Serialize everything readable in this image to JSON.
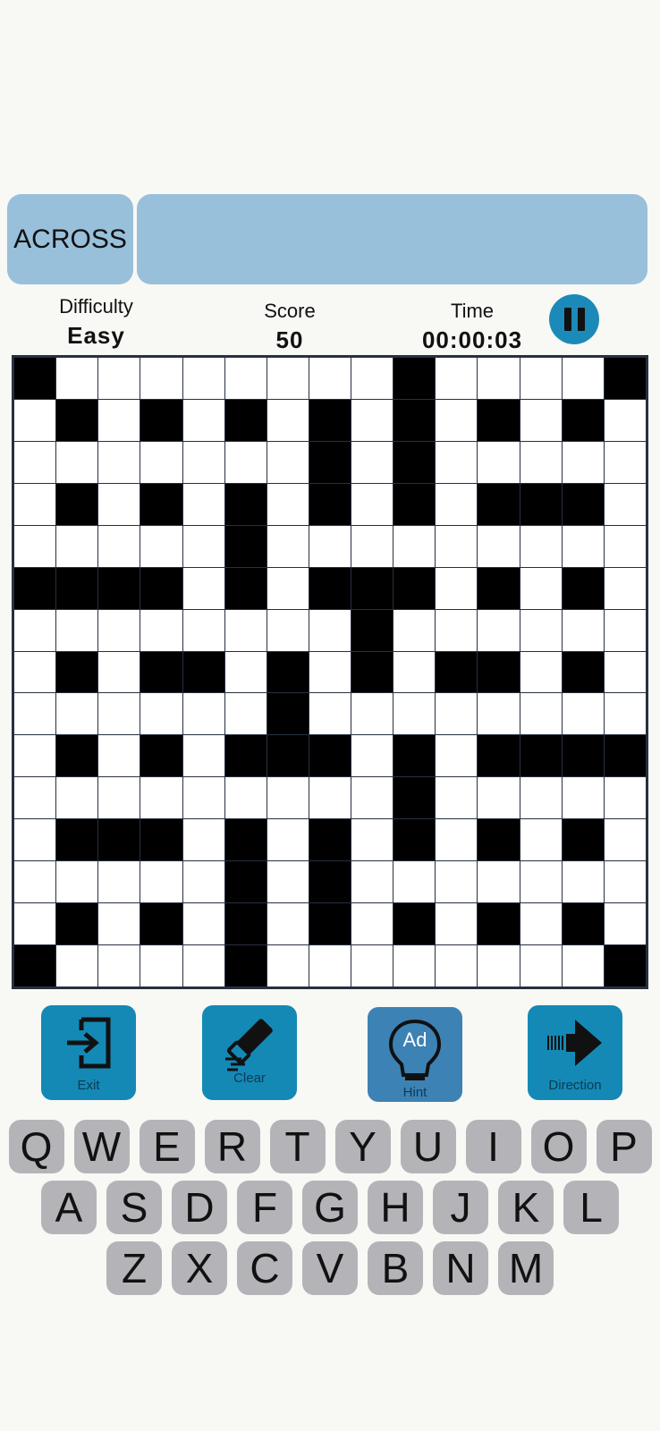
{
  "clue": {
    "direction": "ACROSS",
    "text": ""
  },
  "stats": {
    "difficulty_label": "Difficulty",
    "difficulty_value": "Easy",
    "score_label": "Score",
    "score_value": "50",
    "time_label": "Time",
    "time_value": "00:00:03"
  },
  "grid": {
    "size": 15,
    "rows": [
      "#........#....#",
      ".#.#.#.#.#.#.#.",
      ".......#.#.....",
      ".#.#.#.#.#.###.",
      ".....#.........",
      "####.#.###.#.#.",
      "........#......",
      ".#.##.#.#.##.#.",
      "......#........",
      ".#.#.###.#.####",
      ".........#.....",
      ".###.#.#.#.#.#.",
      ".....#.#.......",
      ".#.#.#.#.#.#.#.",
      "#....#........#"
    ]
  },
  "toolbar": {
    "exit_label": "Exit",
    "clear_label": "Clear",
    "hint_label": "Hint",
    "hint_badge": "Ad",
    "direction_label": "Direction"
  },
  "keyboard": {
    "rows": [
      [
        "Q",
        "W",
        "E",
        "R",
        "T",
        "Y",
        "U",
        "I",
        "O",
        "P"
      ],
      [
        "A",
        "S",
        "D",
        "F",
        "G",
        "H",
        "J",
        "K",
        "L"
      ],
      [
        "Z",
        "X",
        "C",
        "V",
        "B",
        "N",
        "M"
      ]
    ]
  },
  "colors": {
    "clue_bg": "#98c0da",
    "button_bg": "#1489b5",
    "key_bg": "#b4b4b8",
    "block": "#000000"
  }
}
